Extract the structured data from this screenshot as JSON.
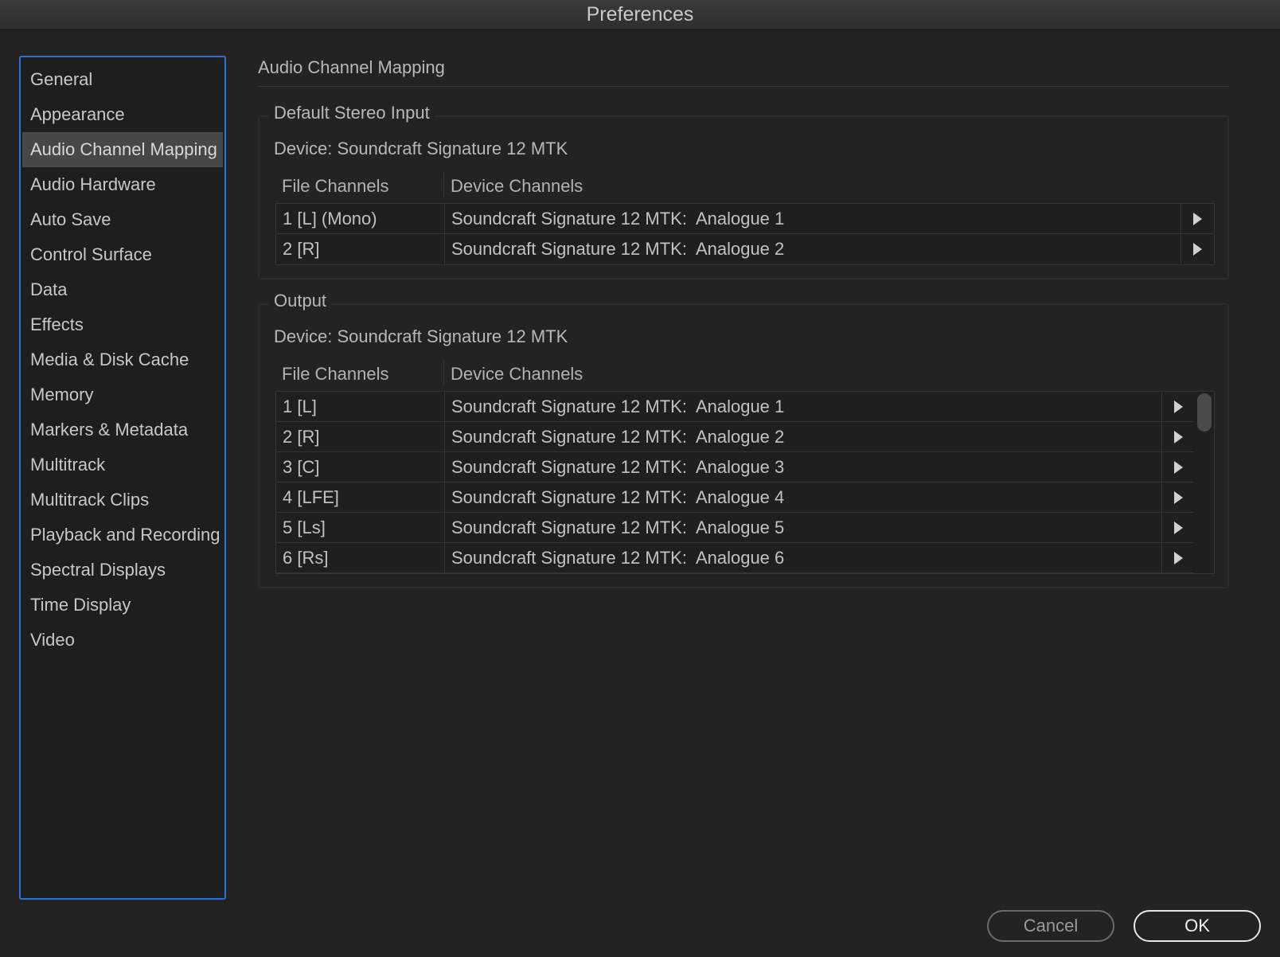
{
  "window": {
    "title": "Preferences"
  },
  "sidebar": {
    "items": [
      {
        "label": "General"
      },
      {
        "label": "Appearance"
      },
      {
        "label": "Audio Channel Mapping",
        "selected": true
      },
      {
        "label": "Audio Hardware"
      },
      {
        "label": "Auto Save"
      },
      {
        "label": "Control Surface"
      },
      {
        "label": "Data"
      },
      {
        "label": "Effects"
      },
      {
        "label": "Media & Disk Cache"
      },
      {
        "label": "Memory"
      },
      {
        "label": "Markers & Metadata"
      },
      {
        "label": "Multitrack"
      },
      {
        "label": "Multitrack Clips"
      },
      {
        "label": "Playback and Recording"
      },
      {
        "label": "Spectral Displays"
      },
      {
        "label": "Time Display"
      },
      {
        "label": "Video"
      }
    ]
  },
  "main": {
    "title": "Audio Channel Mapping",
    "input": {
      "legend": "Default Stereo Input",
      "device": "Device: Soundcraft Signature 12 MTK",
      "columns": [
        "File Channels",
        "Device Channels"
      ],
      "rows": [
        {
          "file": "1 [L] (Mono)",
          "device": "Soundcraft Signature 12 MTK:  Analogue 1"
        },
        {
          "file": "2 [R]",
          "device": "Soundcraft Signature 12 MTK:  Analogue 2"
        }
      ]
    },
    "output": {
      "legend": "Output",
      "device": "Device: Soundcraft Signature 12 MTK",
      "columns": [
        "File Channels",
        "Device Channels"
      ],
      "rows": [
        {
          "file": "1 [L]",
          "device": "Soundcraft Signature 12 MTK:  Analogue 1"
        },
        {
          "file": "2 [R]",
          "device": "Soundcraft Signature 12 MTK:  Analogue 2"
        },
        {
          "file": "3 [C]",
          "device": "Soundcraft Signature 12 MTK:  Analogue 3"
        },
        {
          "file": "4 [LFE]",
          "device": "Soundcraft Signature 12 MTK:  Analogue 4"
        },
        {
          "file": "5 [Ls]",
          "device": "Soundcraft Signature 12 MTK:  Analogue 5"
        },
        {
          "file": "6 [Rs]",
          "device": "Soundcraft Signature 12 MTK:  Analogue 6"
        }
      ]
    }
  },
  "footer": {
    "cancel_label": "Cancel",
    "ok_label": "OK"
  },
  "icons": {
    "row_arrow": "play-triangle-icon"
  },
  "colors": {
    "accent": "#2b74d6",
    "background": "#232323",
    "selected": "#474747"
  }
}
